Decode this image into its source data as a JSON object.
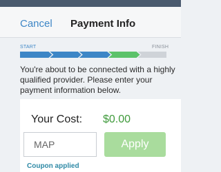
{
  "header": {
    "cancel_label": "Cancel",
    "title": "Payment Info"
  },
  "progress": {
    "start_label": "START",
    "finish_label": "FINISH",
    "total_steps": 5,
    "completed_steps": 3,
    "current_step": 4,
    "colors": {
      "completed": "#3d86c6",
      "current": "#5cc26a",
      "pending": "#cfd3d8"
    }
  },
  "intro_text": "You're about to be connected with a highly qualified provider. Please enter your payment information below.",
  "cost": {
    "label": "Your Cost:",
    "value": "$0.00",
    "value_color": "#3f9a3b"
  },
  "coupon": {
    "input_value": "MAP",
    "apply_label": "Apply",
    "status": "Coupon applied"
  }
}
